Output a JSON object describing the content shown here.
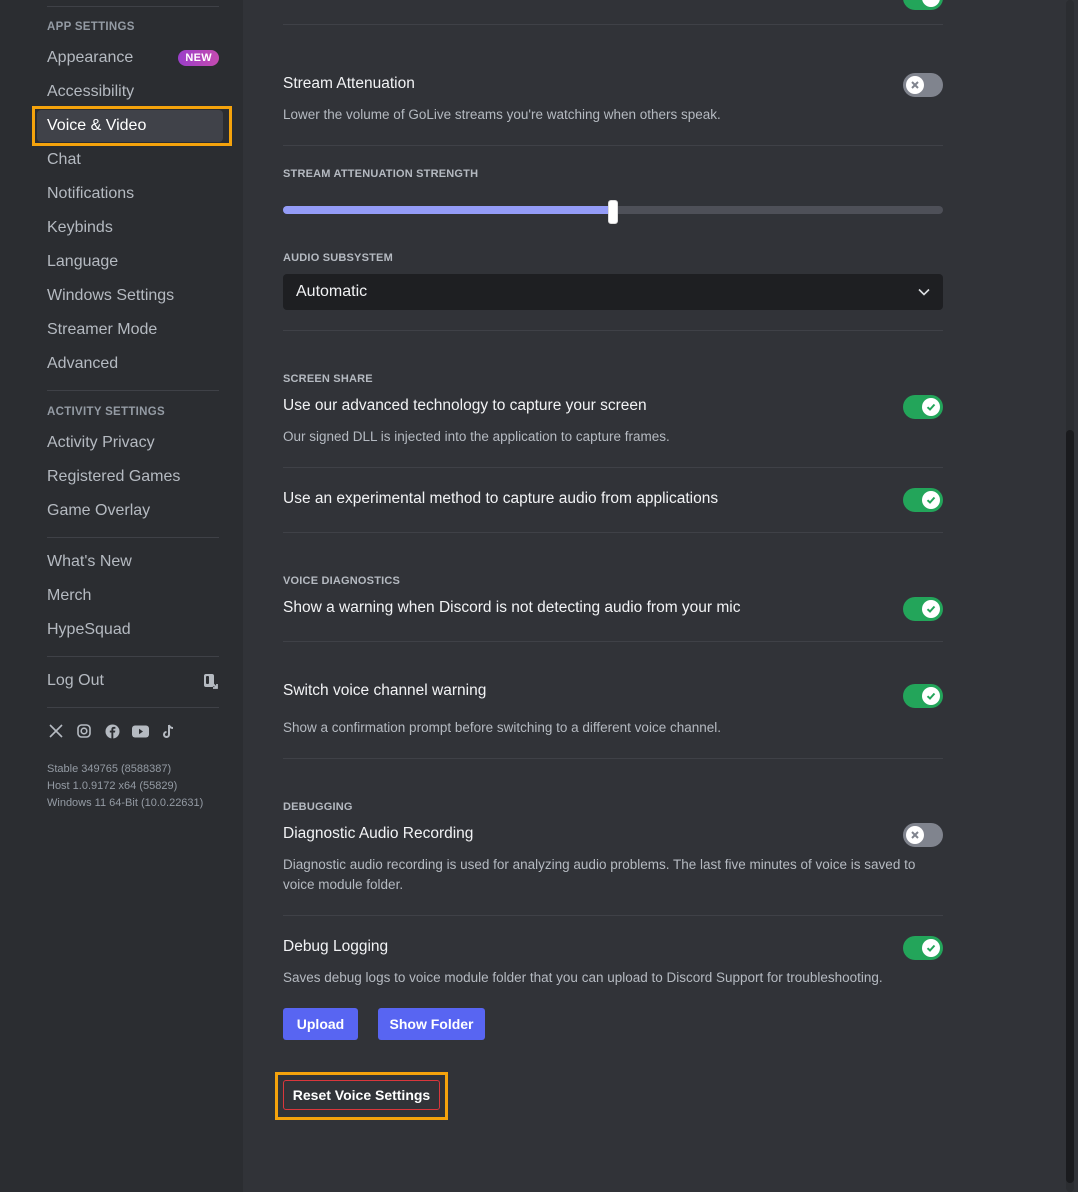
{
  "sidebar": {
    "app_settings_header": "App Settings",
    "app_items": [
      {
        "label": "Appearance",
        "badge": "NEW"
      },
      {
        "label": "Accessibility"
      },
      {
        "label": "Voice & Video",
        "selected": true
      },
      {
        "label": "Chat"
      },
      {
        "label": "Notifications"
      },
      {
        "label": "Keybinds"
      },
      {
        "label": "Language"
      },
      {
        "label": "Windows Settings"
      },
      {
        "label": "Streamer Mode"
      },
      {
        "label": "Advanced"
      }
    ],
    "activity_settings_header": "Activity Settings",
    "activity_items": [
      {
        "label": "Activity Privacy"
      },
      {
        "label": "Registered Games"
      },
      {
        "label": "Game Overlay"
      }
    ],
    "misc_items": [
      {
        "label": "What's New"
      },
      {
        "label": "Merch"
      },
      {
        "label": "HypeSquad"
      }
    ],
    "logout_label": "Log Out",
    "logout_icon": "logout-icon",
    "socials": [
      "x-icon",
      "instagram-icon",
      "facebook-icon",
      "youtube-icon",
      "tiktok-icon"
    ],
    "version": {
      "stable": "Stable 349765 (8588387)",
      "host": "Host 1.0.9172 x64 (55829)",
      "os": "Windows 11 64-Bit (10.0.22631)"
    }
  },
  "main": {
    "stream_attenuation": {
      "title": "Stream Attenuation",
      "description": "Lower the volume of GoLive streams you're watching when others speak.",
      "enabled": false
    },
    "stream_attenuation_strength": {
      "header": "Stream Attenuation Strength",
      "value_percent": 50
    },
    "audio_subsystem": {
      "header": "Audio Subsystem",
      "selected": "Automatic"
    },
    "screen_share": {
      "header": "Screen Share",
      "advanced_capture": {
        "title": "Use our advanced technology to capture your screen",
        "description": "Our signed DLL is injected into the application to capture frames.",
        "enabled": true
      },
      "experimental_audio": {
        "title": "Use an experimental method to capture audio from applications",
        "enabled": true
      }
    },
    "voice_diagnostics": {
      "header": "Voice Diagnostics",
      "mic_warning": {
        "title": "Show a warning when Discord is not detecting audio from your mic",
        "enabled": true
      },
      "switch_warning": {
        "title": "Switch voice channel warning",
        "description": "Show a confirmation prompt before switching to a different voice channel.",
        "enabled": true
      }
    },
    "debugging": {
      "header": "Debugging",
      "diagnostic_recording": {
        "title": "Diagnostic Audio Recording",
        "description": "Diagnostic audio recording is used for analyzing audio problems. The last five minutes of voice is saved to voice module folder.",
        "enabled": false
      },
      "debug_logging": {
        "title": "Debug Logging",
        "description": "Saves debug logs to voice module folder that you can upload to Discord Support for troubleshooting.",
        "enabled": true
      },
      "upload_label": "Upload",
      "show_folder_label": "Show Folder"
    },
    "reset_label": "Reset Voice Settings"
  },
  "colors": {
    "toggle_on": "#23a55a",
    "toggle_off": "#80848e",
    "brand": "#5865f2",
    "slider_fill": "#949cf7",
    "danger": "#da373c",
    "highlight": "#f5a30c"
  }
}
